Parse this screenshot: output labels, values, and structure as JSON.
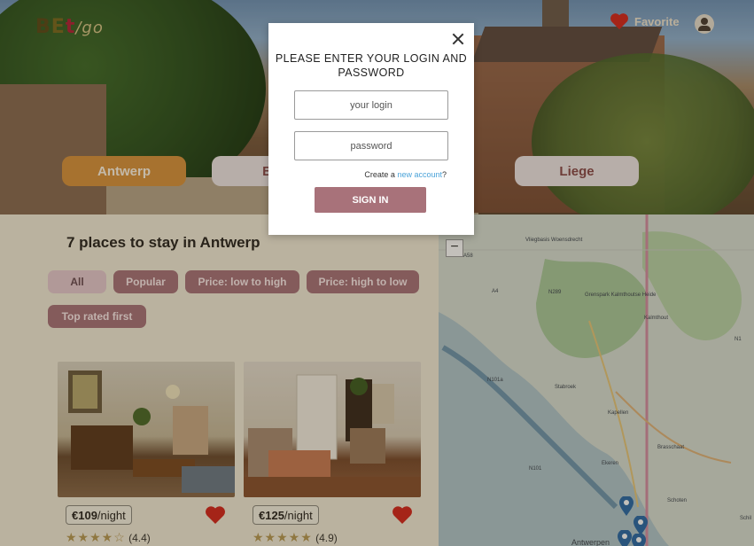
{
  "header": {
    "logo_b": "B",
    "logo_e": "E",
    "logo_t": "t",
    "logo_go": "/go",
    "favorite_label": "Favorite"
  },
  "cities": [
    "Antwerp",
    "Bru",
    "Liege"
  ],
  "results": {
    "title": "7 places to stay in Antwerp"
  },
  "filters": [
    "All",
    "Popular",
    "Price: low to high",
    "Price: high to low",
    "Top rated first"
  ],
  "listings": [
    {
      "price": "€109",
      "unit": "/night",
      "rating": "(4.4)",
      "stars": 4.4
    },
    {
      "price": "€125",
      "unit": "/night",
      "rating": "(4.9)",
      "stars": 4.9
    }
  ],
  "map": {
    "zoom_out": "−",
    "labels": [
      "A58",
      "Vliegbasis Woensdrecht",
      "N289",
      "A4",
      "Grenspark Kalmthoutse Heide",
      "Kalmthout",
      "N1",
      "N101a",
      "Stabroek",
      "Kapellen",
      "Brasschaat",
      "N101",
      "Ekeren",
      "Schoten",
      "Antwerpen",
      "Schil"
    ]
  },
  "modal": {
    "heading": "PLEASE ENTER YOUR LOGIN AND PASSWORD",
    "login_placeholder": "your login",
    "password_placeholder": "password",
    "create_prefix": "Create a ",
    "create_link": "new account",
    "create_suffix": "?",
    "signin_label": "SIGN IN"
  },
  "colors": {
    "accent": "#a8737b",
    "active_city": "#d8943e",
    "link": "#4ba3d9",
    "heart": "#d6281e"
  }
}
